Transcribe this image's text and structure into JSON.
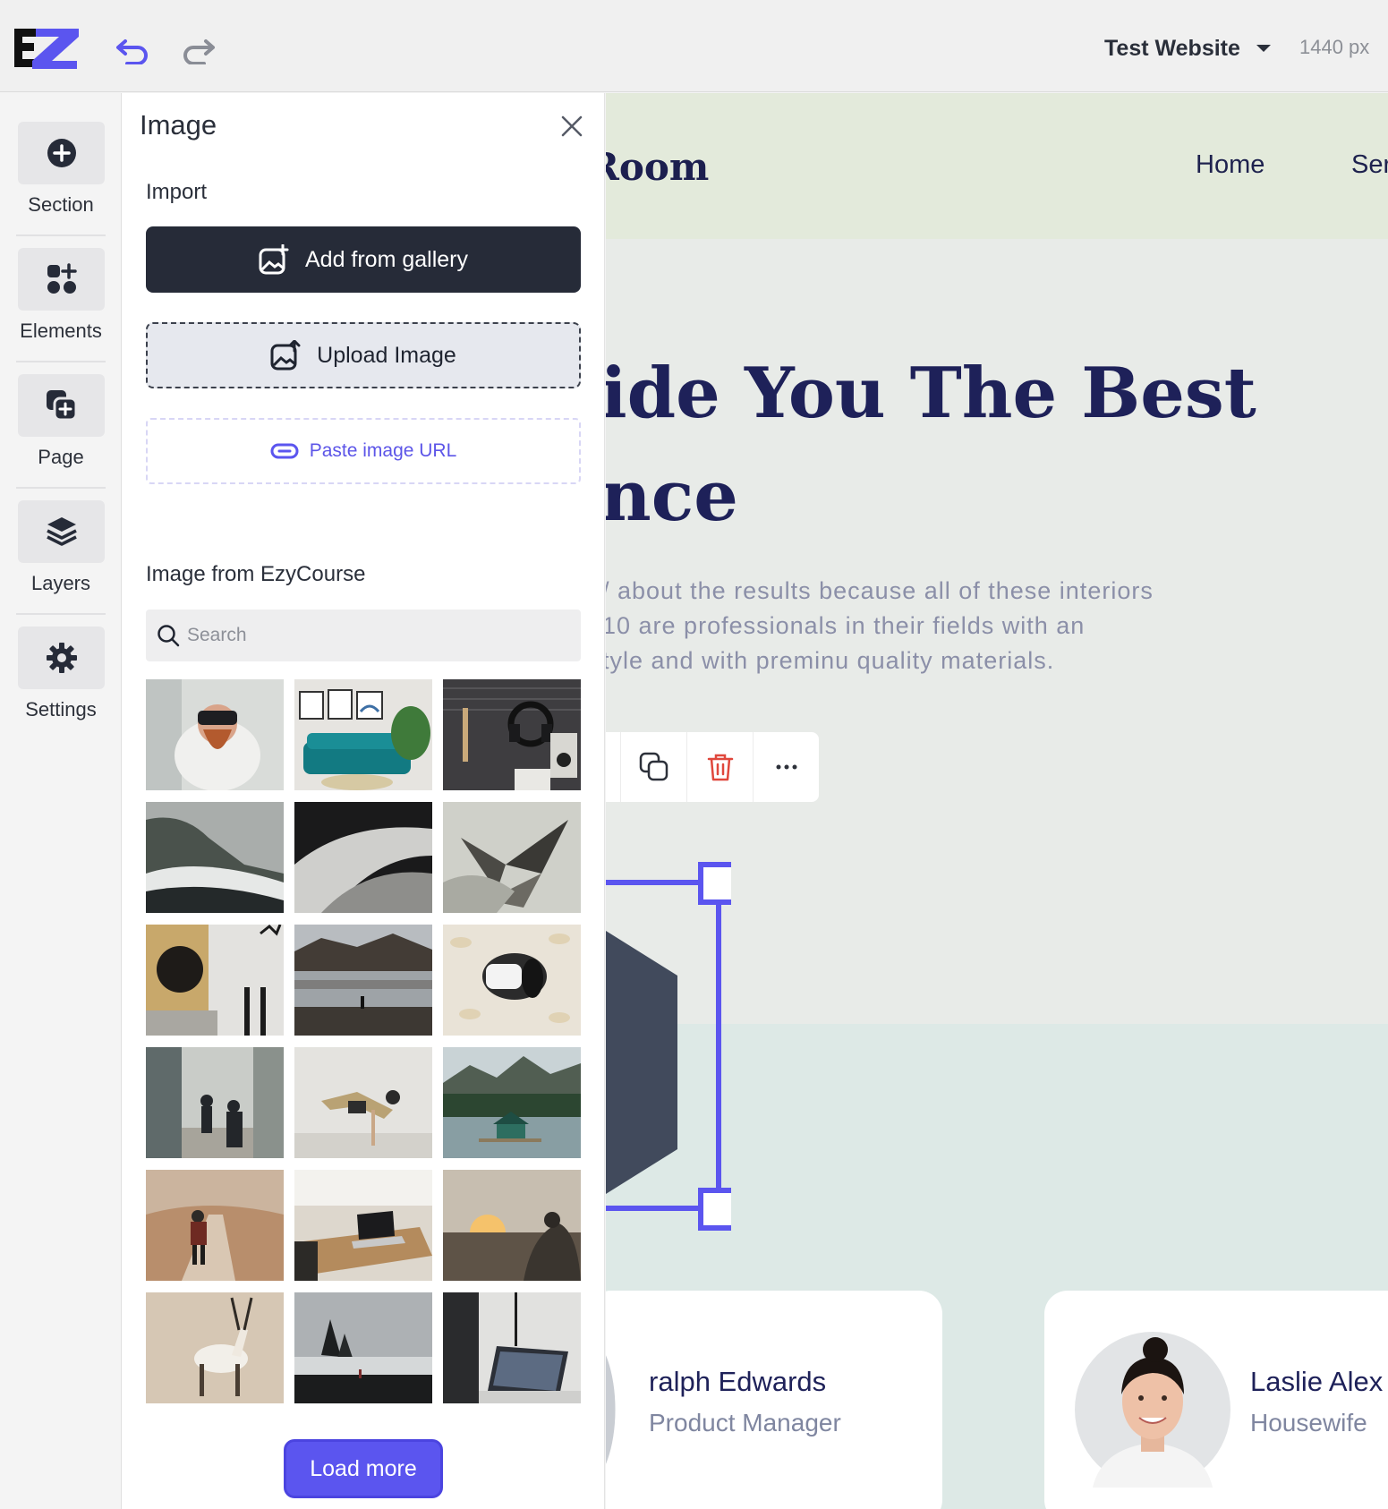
{
  "topbar": {
    "site_name": "Test Website",
    "width_readout": "1440 px",
    "undo_icon": "undo-icon",
    "redo_icon": "redo-icon",
    "brand_color": "#5b55ef"
  },
  "rail": {
    "items": [
      {
        "label": "Section",
        "icon": "plus-circle-icon"
      },
      {
        "label": "Elements",
        "icon": "elements-icon"
      },
      {
        "label": "Page",
        "icon": "page-add-icon"
      },
      {
        "label": "Layers",
        "icon": "layers-icon"
      },
      {
        "label": "Settings",
        "icon": "gear-icon"
      }
    ]
  },
  "panel": {
    "title": "Image",
    "import_label": "Import",
    "add_gallery_label": "Add from gallery",
    "upload_label": "Upload Image",
    "paste_url_label": "Paste image URL",
    "library_label": "Image from EzyCourse",
    "search_placeholder": "Search",
    "load_more_label": "Load more"
  },
  "canvas": {
    "site_logo": "Room",
    "nav": [
      "Home",
      "Ser"
    ],
    "hero_line1": "ide You The Best",
    "hero_line2": "nce",
    "hero_para": [
      "/ about the results because all of these interiors",
      "10 are professionals in their fields with an",
      "tyle and with preminu quality materials."
    ],
    "cards": [
      {
        "name": "ralph Edwards",
        "role": "Product Manager"
      },
      {
        "name": "Laslie Alex",
        "role": "Housewife"
      }
    ]
  }
}
